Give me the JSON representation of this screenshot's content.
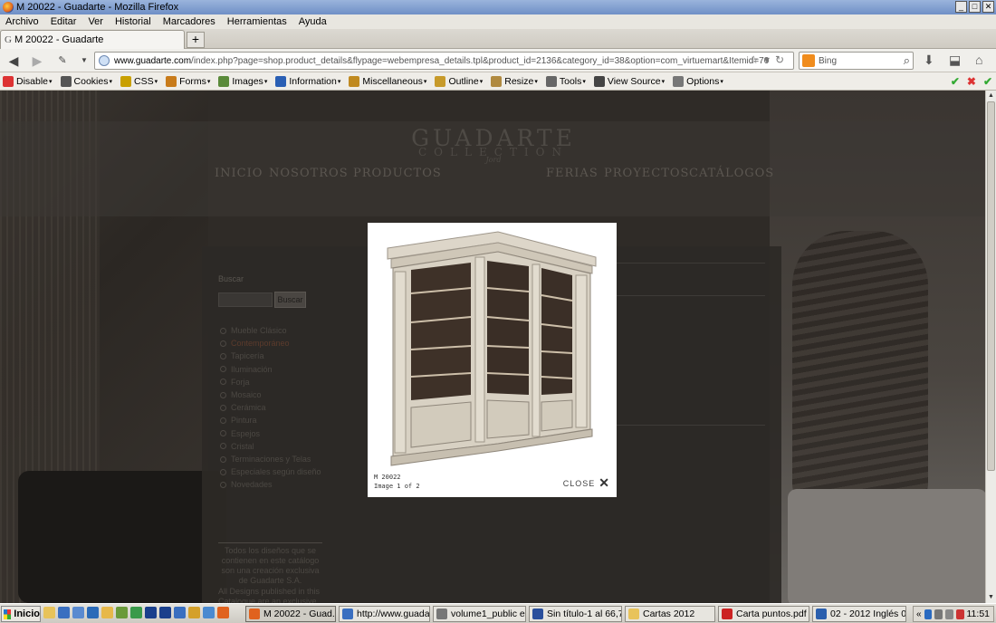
{
  "window": {
    "title": "M 20022 - Guadarte - Mozilla Firefox",
    "controls": [
      "_",
      "□",
      "✕"
    ]
  },
  "menu": [
    "Archivo",
    "Editar",
    "Ver",
    "Historial",
    "Marcadores",
    "Herramientas",
    "Ayuda"
  ],
  "tab": {
    "label": "M 20022 - Guadarte",
    "new_tab": "+"
  },
  "nav": {
    "url_host": "www.guadarte.com",
    "url_path": "/index.php?page=shop.product_details&flypage=webempresa_details.tpl&product_id=2136&category_id=38&option=com_virtuemart&Itemid=70",
    "search_placeholder": "Bing"
  },
  "devtoolbar": [
    {
      "label": "Disable",
      "color": "#d33"
    },
    {
      "label": "Cookies",
      "color": "#555"
    },
    {
      "label": "CSS",
      "color": "#c9a000"
    },
    {
      "label": "Forms",
      "color": "#c87b1a"
    },
    {
      "label": "Images",
      "color": "#5a8a3a"
    },
    {
      "label": "Information",
      "color": "#2a5fb4"
    },
    {
      "label": "Miscellaneous",
      "color": "#c08a20"
    },
    {
      "label": "Outline",
      "color": "#c79a2a"
    },
    {
      "label": "Resize",
      "color": "#b08a40"
    },
    {
      "label": "Tools",
      "color": "#666"
    },
    {
      "label": "View Source",
      "color": "#444"
    },
    {
      "label": "Options",
      "color": "#777"
    }
  ],
  "site": {
    "logo": {
      "name": "GUADARTE",
      "sub": "COLLECTION",
      "sub2": "Jord"
    },
    "nav_items": [
      "INICIO",
      "NOSOTROS",
      "PRODUCTOS",
      "FERIAS",
      "PROYECTOS",
      "CATÁLOGOS"
    ],
    "search": {
      "label": "Buscar",
      "button": "Buscar"
    },
    "categories": [
      "Mueble Clásico",
      "Contemporáneo",
      "Tapicería",
      "Iluminación",
      "Forja",
      "Mosaico",
      "Cerámica",
      "Pintura",
      "Espejos",
      "Cristal",
      "Terminaciones y Telas",
      "Especiales según diseño",
      "Novedades"
    ],
    "active_category": 1,
    "footer_note": "Todos los diseños que se contienen en este catálogo son una creación exclusiva de Guadarte S.A.",
    "footer_note2": "All Designs published in this Catalogue are an exclusive"
  },
  "modal": {
    "title": "M 20022",
    "counter": "Image 1 of 2",
    "close": "CLOSE"
  },
  "taskbar": {
    "start": "Inicio",
    "tasks": [
      {
        "label": "M 20022 - Guad...",
        "color": "#e0621e",
        "active": true
      },
      {
        "label": "http://www.guada...",
        "color": "#3a6fc0",
        "active": false
      },
      {
        "label": "volume1_public e...",
        "color": "#777",
        "active": false
      },
      {
        "label": "Sin título-1 al 66,7...",
        "color": "#2a4f9c",
        "active": false
      },
      {
        "label": "Cartas 2012",
        "color": "#e8c35a",
        "active": false
      },
      {
        "label": "Carta puntos.pdf -...",
        "color": "#c22",
        "active": false
      },
      {
        "label": "02 - 2012 Inglés 0...",
        "color": "#2b5fad",
        "active": false
      }
    ],
    "tray_expand": "«",
    "clock": "11:51"
  }
}
